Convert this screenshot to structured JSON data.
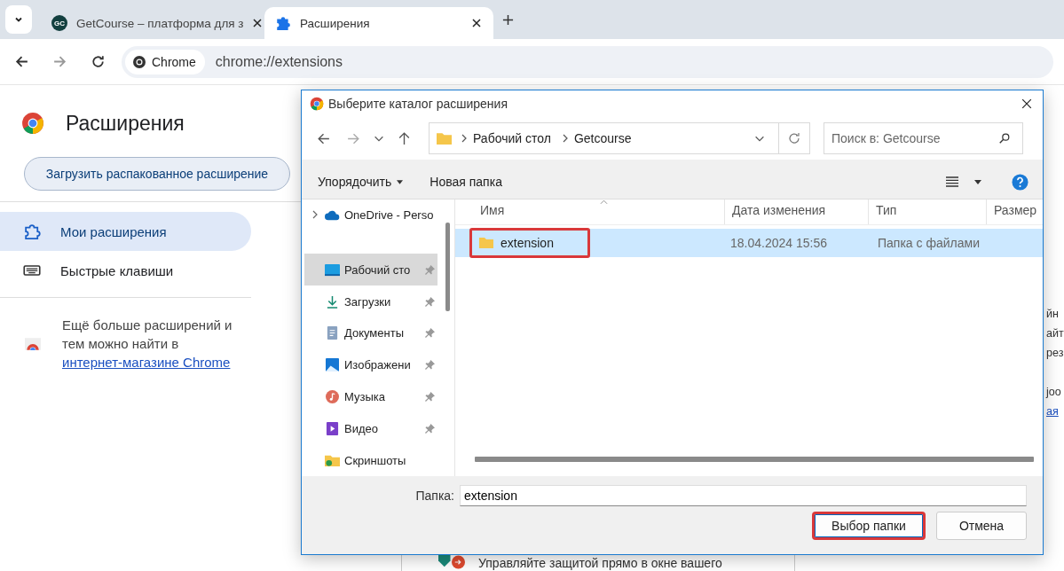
{
  "browser": {
    "tabs": [
      {
        "title": "GetCourse – платформа для з",
        "icon_text": "GC",
        "selected": false
      },
      {
        "title": "Расширения",
        "selected": true
      }
    ],
    "address": {
      "chip": "Chrome",
      "url": "chrome://extensions"
    }
  },
  "page": {
    "title": "Расширения",
    "load_button": "Загрузить распакованное расширение",
    "nav": [
      {
        "label": "Мои расширения",
        "selected": true
      },
      {
        "label": "Быстрые клавиши",
        "selected": false
      }
    ],
    "promo": {
      "text": "Ещё больше расширений и тем можно найти в",
      "link": "интернет-магазине Chrome"
    },
    "right_card_fragments": [
      {
        "text": "йн",
        "kind": "text"
      },
      {
        "text": "айт",
        "kind": "text"
      },
      {
        "text": "рез",
        "kind": "text"
      },
      {
        "text": "joo",
        "kind": "text"
      },
      {
        "text": "ая",
        "kind": "link"
      }
    ],
    "bottom_card": {
      "text": "Управляйте защитой прямо в окне вашего"
    }
  },
  "dialog": {
    "title": "Выберите каталог расширения",
    "breadcrumb": [
      "Рабочий стол",
      "Getcourse"
    ],
    "search": {
      "placeholder": "Поиск в: Getcourse"
    },
    "commands": [
      {
        "label": "Упорядочить",
        "dropdown": true
      },
      {
        "label": "Новая папка",
        "dropdown": false
      }
    ],
    "tree": [
      {
        "label": "OneDrive - Perso",
        "expandable": true,
        "pinned": false,
        "selected": false
      },
      {
        "label": "Рабочий сто",
        "expandable": false,
        "pinned": true,
        "selected": true
      },
      {
        "label": "Загрузки",
        "expandable": false,
        "pinned": true,
        "selected": false
      },
      {
        "label": "Документы",
        "expandable": false,
        "pinned": true,
        "selected": false
      },
      {
        "label": "Изображени",
        "expandable": false,
        "pinned": true,
        "selected": false
      },
      {
        "label": "Музыка",
        "expandable": false,
        "pinned": true,
        "selected": false
      },
      {
        "label": "Видео",
        "expandable": false,
        "pinned": true,
        "selected": false
      },
      {
        "label": "Скриншоты",
        "expandable": false,
        "pinned": false,
        "selected": false
      }
    ],
    "columns": [
      "Имя",
      "Дата изменения",
      "Тип",
      "Размер"
    ],
    "rows": [
      {
        "name": "extension",
        "date": "18.04.2024 15:56",
        "type": "Папка с файлами",
        "selected": true,
        "highlighted": true
      }
    ],
    "folder_label": "Папка:",
    "folder_value": "extension",
    "buttons": [
      {
        "label": "Выбор папки",
        "kind": "primary",
        "highlighted": true
      },
      {
        "label": "Отмена",
        "kind": "secondary",
        "highlighted": false
      }
    ]
  }
}
